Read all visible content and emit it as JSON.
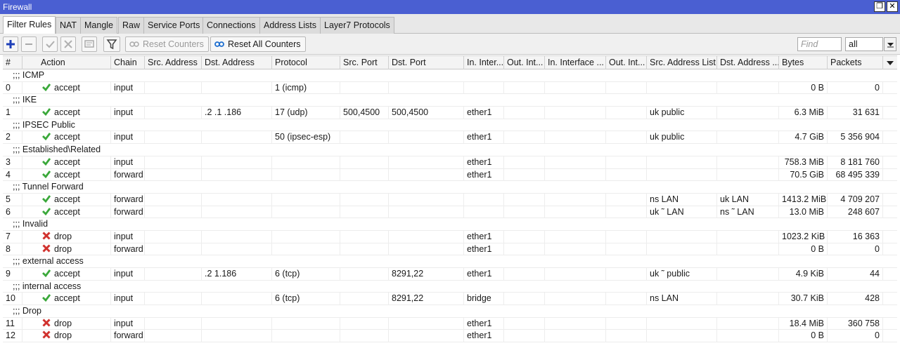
{
  "window": {
    "title": "Firewall",
    "maximize_glyph": "❐",
    "close_glyph": "✕"
  },
  "tabs": [
    "Filter Rules",
    "NAT",
    "Mangle",
    "Raw",
    "Service Ports",
    "Connections",
    "Address Lists",
    "Layer7 Protocols"
  ],
  "toolbar": {
    "reset_counters": "Reset Counters",
    "reset_all_counters": "Reset All Counters",
    "find_placeholder": "Find",
    "filter_value": "all"
  },
  "columns": [
    "#",
    "Action",
    "Chain",
    "Src. Address",
    "Dst. Address",
    "Protocol",
    "Src. Port",
    "Dst. Port",
    "In. Inter...",
    "Out. Int...",
    "In. Interface ...",
    "Out. Int...",
    "Src. Address List",
    "Dst. Address ...",
    "Bytes",
    "Packets"
  ],
  "rows": [
    {
      "comment": ";;; ICMP"
    },
    {
      "num": "0",
      "action": "accept",
      "chain": "input",
      "src": "",
      "dst": "",
      "proto": "1 (icmp)",
      "sport": "",
      "dport": "",
      "in": "",
      "out": "",
      "inlist": "",
      "outlist": "",
      "srclist": "",
      "dstlist": "",
      "bytes": "0 B",
      "packets": "0"
    },
    {
      "comment": ";;; IKE"
    },
    {
      "num": "1",
      "action": "accept",
      "chain": "input",
      "src": "",
      "dst": ".2    .1    .186",
      "proto": "17 (udp)",
      "sport": "500,4500",
      "dport": "500,4500",
      "in": "ether1",
      "out": "",
      "inlist": "",
      "outlist": "",
      "srclist": "uk       public",
      "dstlist": "",
      "bytes": "6.3 MiB",
      "packets": "31 631"
    },
    {
      "comment": ";;; IPSEC Public"
    },
    {
      "num": "2",
      "action": "accept",
      "chain": "input",
      "src": "",
      "dst": "",
      "proto": "50 (ipsec-esp)",
      "sport": "",
      "dport": "",
      "in": "ether1",
      "out": "",
      "inlist": "",
      "outlist": "",
      "srclist": "uk       public",
      "dstlist": "",
      "bytes": "4.7 GiB",
      "packets": "5 356 904"
    },
    {
      "comment": ";;; Established\\Related"
    },
    {
      "num": "3",
      "action": "accept",
      "chain": "input",
      "src": "",
      "dst": "",
      "proto": "",
      "sport": "",
      "dport": "",
      "in": "ether1",
      "out": "",
      "inlist": "",
      "outlist": "",
      "srclist": "",
      "dstlist": "",
      "bytes": "758.3 MiB",
      "packets": "8 181 760"
    },
    {
      "num": "4",
      "action": "accept",
      "chain": "forward",
      "src": "",
      "dst": "",
      "proto": "",
      "sport": "",
      "dport": "",
      "in": "ether1",
      "out": "",
      "inlist": "",
      "outlist": "",
      "srclist": "",
      "dstlist": "",
      "bytes": "70.5 GiB",
      "packets": "68 495 339"
    },
    {
      "comment": ";;; Tunnel Forward"
    },
    {
      "num": "5",
      "action": "accept",
      "chain": "forward",
      "src": "",
      "dst": "",
      "proto": "",
      "sport": "",
      "dport": "",
      "in": "",
      "out": "",
      "inlist": "",
      "outlist": "",
      "srclist": "ns       LAN",
      "dstlist": "uk       LAN",
      "bytes": "1413.2 MiB",
      "packets": "4 709 207"
    },
    {
      "num": "6",
      "action": "accept",
      "chain": "forward",
      "src": "",
      "dst": "",
      "proto": "",
      "sport": "",
      "dport": "",
      "in": "",
      "out": "",
      "inlist": "",
      "outlist": "",
      "srclist": "uk     ˜ LAN",
      "dstlist": "ns     ˜ LAN",
      "bytes": "13.0 MiB",
      "packets": "248 607"
    },
    {
      "comment": ";;; Invalid"
    },
    {
      "num": "7",
      "action": "drop",
      "chain": "input",
      "src": "",
      "dst": "",
      "proto": "",
      "sport": "",
      "dport": "",
      "in": "ether1",
      "out": "",
      "inlist": "",
      "outlist": "",
      "srclist": "",
      "dstlist": "",
      "bytes": "1023.2 KiB",
      "packets": "16 363"
    },
    {
      "num": "8",
      "action": "drop",
      "chain": "forward",
      "src": "",
      "dst": "",
      "proto": "",
      "sport": "",
      "dport": "",
      "in": "ether1",
      "out": "",
      "inlist": "",
      "outlist": "",
      "srclist": "",
      "dstlist": "",
      "bytes": "0 B",
      "packets": "0"
    },
    {
      "comment": ";;; external access"
    },
    {
      "num": "9",
      "action": "accept",
      "chain": "input",
      "src": "",
      "dst": ".2         1.186",
      "proto": "6 (tcp)",
      "sport": "",
      "dport": "8291,22",
      "in": "ether1",
      "out": "",
      "inlist": "",
      "outlist": "",
      "srclist": "uk     ˜ public",
      "dstlist": "",
      "bytes": "4.9 KiB",
      "packets": "44"
    },
    {
      "comment": ";;; internal access"
    },
    {
      "num": "10",
      "action": "accept",
      "chain": "input",
      "src": "",
      "dst": "",
      "proto": "6 (tcp)",
      "sport": "",
      "dport": "8291,22",
      "in": "bridge",
      "out": "",
      "inlist": "",
      "outlist": "",
      "srclist": "ns       LAN",
      "dstlist": "",
      "bytes": "30.7 KiB",
      "packets": "428"
    },
    {
      "comment": ";;; Drop"
    },
    {
      "num": "11",
      "action": "drop",
      "chain": "input",
      "src": "",
      "dst": "",
      "proto": "",
      "sport": "",
      "dport": "",
      "in": "ether1",
      "out": "",
      "inlist": "",
      "outlist": "",
      "srclist": "",
      "dstlist": "",
      "bytes": "18.4 MiB",
      "packets": "360 758"
    },
    {
      "num": "12",
      "action": "drop",
      "chain": "forward",
      "src": "",
      "dst": "",
      "proto": "",
      "sport": "",
      "dport": "",
      "in": "ether1",
      "out": "",
      "inlist": "",
      "outlist": "",
      "srclist": "",
      "dstlist": "",
      "bytes": "0 B",
      "packets": "0"
    }
  ],
  "colors": {
    "titlebar": "#4a5fd2",
    "accept_icon": "#3aa83a",
    "drop_icon": "#d0312d",
    "add_icon": "#1e3fb8"
  }
}
